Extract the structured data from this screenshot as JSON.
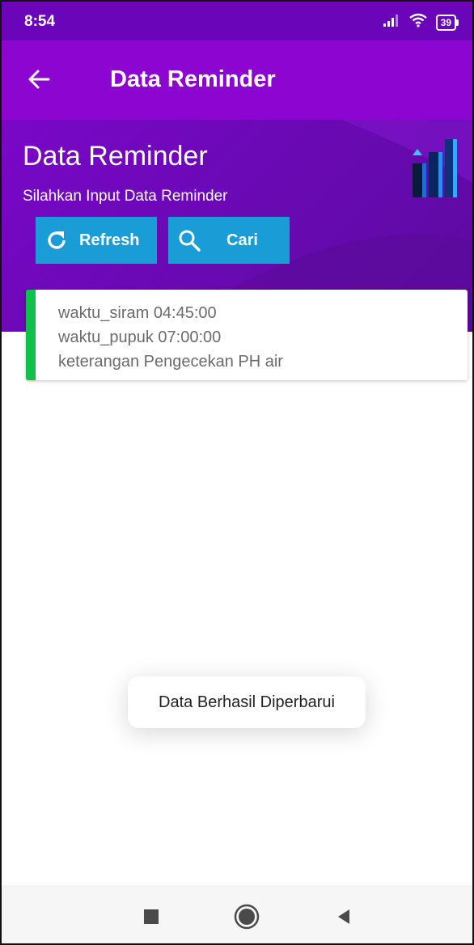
{
  "status_bar": {
    "time": "8:54",
    "battery": "39",
    "icons": [
      "signal-icon",
      "wifi-icon",
      "battery-icon"
    ]
  },
  "app_bar": {
    "title": "Data Reminder",
    "back_icon": "arrow-left-icon"
  },
  "banner": {
    "title": "Data Reminder",
    "subtitle": "Silahkan Input Data Reminder",
    "decor_icon": "bar-chart-icon"
  },
  "buttons": {
    "refresh": {
      "label": "Refresh",
      "icon": "refresh-icon"
    },
    "search": {
      "label": "Cari",
      "icon": "search-icon"
    }
  },
  "reminders": [
    {
      "waktu_siram": "waktu_siram 04:45:00",
      "waktu_pupuk": "waktu_pupuk 07:00:00",
      "keterangan": "keterangan Pengecekan PH air"
    }
  ],
  "toast": {
    "message": "Data Berhasil Diperbarui"
  },
  "nav": {
    "recents_icon": "square-icon",
    "home_icon": "circle-icon",
    "back_icon": "triangle-back-icon"
  },
  "colors": {
    "status_bar": "#6a05b9",
    "app_bar": "#8c05d1",
    "banner": "#6a09b5",
    "button": "#1a9cd6",
    "card_accent": "#10c04a"
  }
}
